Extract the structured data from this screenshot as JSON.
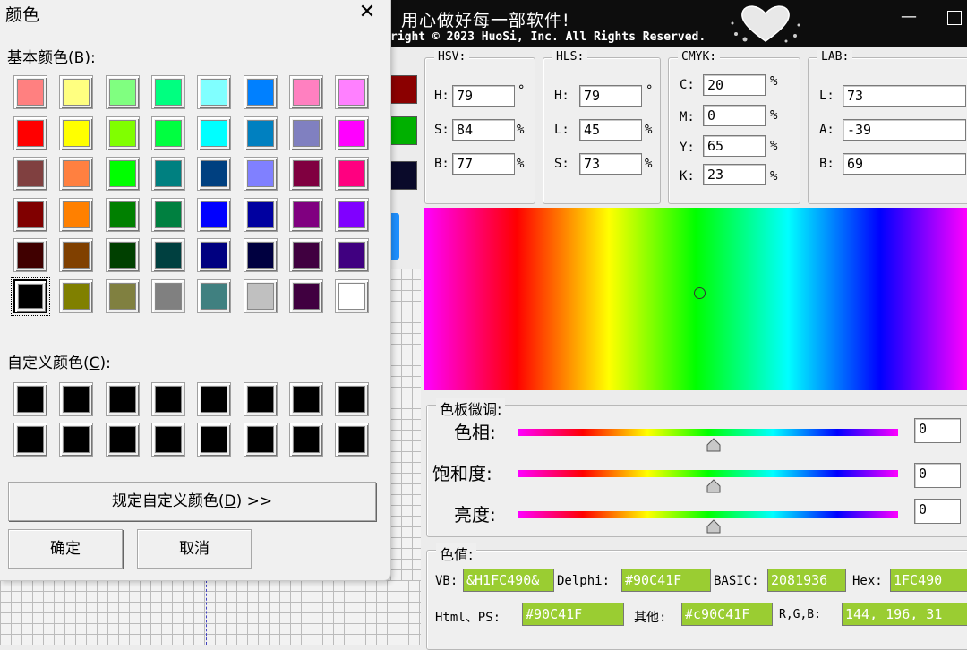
{
  "banner": {
    "title": "用心做好每一部软件!",
    "copyright": "right © 2023 HuoSi, Inc. All Rights Reserved.",
    "minimize_glyph": "—"
  },
  "hsv": {
    "legend": "HSV:",
    "h_label": "H:",
    "s_label": "S:",
    "b_label": "B:",
    "h": "79",
    "s": "84",
    "b": "77",
    "h_unit": "°",
    "s_unit": "%",
    "b_unit": "%"
  },
  "hls": {
    "legend": "HLS:",
    "h_label": "H:",
    "l_label": "L:",
    "s_label": "S:",
    "h": "79",
    "l": "45",
    "s": "73",
    "h_unit": "°",
    "l_unit": "%",
    "s_unit": "%"
  },
  "cmyk": {
    "legend": "CMYK:",
    "c_label": "C:",
    "m_label": "M:",
    "y_label": "Y:",
    "k_label": "K:",
    "c": "20",
    "m": "0",
    "y": "65",
    "k": "23",
    "unit": "%"
  },
  "lab": {
    "legend": "LAB:",
    "l_label": "L:",
    "a_label": "A:",
    "b_label": "B:",
    "l": "73",
    "a": "-39",
    "b": "69"
  },
  "tune": {
    "legend": "色板微调:",
    "hue_label": "色相:",
    "sat_label": "饱和度:",
    "bright_label": "亮度:",
    "hue_value": "0",
    "sat_value": "0",
    "bright_value": "0"
  },
  "values": {
    "legend": "色值:",
    "vb_label": "VB:",
    "vb": "&H1FC490&",
    "delphi_label": "Delphi:",
    "delphi": "#90C41F",
    "basic_label": "BASIC:",
    "basic": "2081936",
    "hex_label": "Hex:",
    "hex": "1FC490",
    "html_label": "Html、PS:",
    "html": "#90C41F",
    "other_label": "其他:",
    "other": "#c90C41F",
    "rgb_label": "R,G,B:",
    "rgb": "144, 196, 31"
  },
  "dialog": {
    "title": "颜色",
    "close_glyph": "✕",
    "basic_label_pre": "基本颜色(",
    "basic_label_key": "B",
    "basic_label_post": "):",
    "custom_label_pre": "自定义颜色(",
    "custom_label_key": "C",
    "custom_label_post": "):",
    "define_pre": "规定自定义颜色(",
    "define_key": "D",
    "define_post": ") >>",
    "ok": "确定",
    "cancel": "取消",
    "selected_index": 40,
    "basic_colors": [
      "#ff8080",
      "#ffff80",
      "#80ff80",
      "#00ff80",
      "#80ffff",
      "#0080ff",
      "#ff80c0",
      "#ff80ff",
      "#ff0000",
      "#ffff00",
      "#80ff00",
      "#00ff40",
      "#00ffff",
      "#0080c0",
      "#8080c0",
      "#ff00ff",
      "#804040",
      "#ff8040",
      "#00ff00",
      "#008080",
      "#004080",
      "#8080ff",
      "#800040",
      "#ff0080",
      "#800000",
      "#ff8000",
      "#008000",
      "#008040",
      "#0000ff",
      "#0000a0",
      "#800080",
      "#8000ff",
      "#400000",
      "#804000",
      "#004000",
      "#004040",
      "#000080",
      "#000040",
      "#400040",
      "#400080",
      "#000000",
      "#808000",
      "#808040",
      "#808080",
      "#408080",
      "#c0c0c0",
      "#400040",
      "#ffffff"
    ],
    "custom_colors": [
      "#000000",
      "#000000",
      "#000000",
      "#000000",
      "#000000",
      "#000000",
      "#000000",
      "#000000",
      "#000000",
      "#000000",
      "#000000",
      "#000000",
      "#000000",
      "#000000",
      "#000000",
      "#000000"
    ]
  },
  "side_swatches": [
    "#8b0000",
    "#00b000",
    "#0a0a2a"
  ],
  "accent_green": "#9acd32"
}
